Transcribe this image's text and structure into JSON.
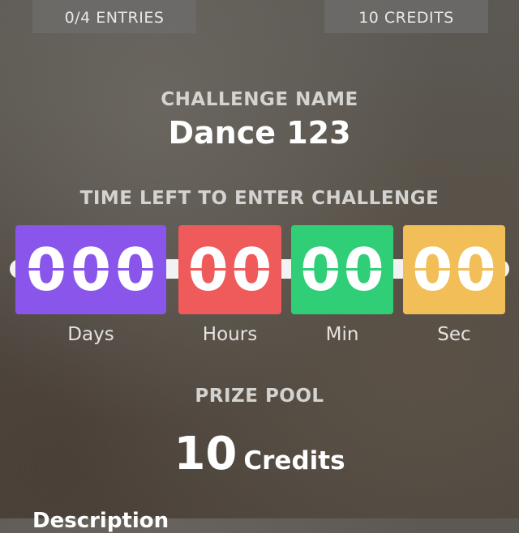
{
  "header": {
    "entries_label": "0/4 ENTRIES",
    "credits_label": "10 CREDITS"
  },
  "challenge": {
    "name_label": "CHALLENGE NAME",
    "name": "Dance 123"
  },
  "timer": {
    "label": "TIME LEFT TO ENTER CHALLENGE",
    "days": {
      "digits": [
        "0",
        "0",
        "0"
      ],
      "unit": "Days",
      "color": "#8a55ea"
    },
    "hours": {
      "digits": [
        "0",
        "0"
      ],
      "unit": "Hours",
      "color": "#ef5a5a"
    },
    "min": {
      "digits": [
        "0",
        "0"
      ],
      "unit": "Min",
      "color": "#2fce77"
    },
    "sec": {
      "digits": [
        "0",
        "0"
      ],
      "unit": "Sec",
      "color": "#f2be57"
    }
  },
  "prize": {
    "label": "PRIZE POOL",
    "amount": "10",
    "unit": "Credits"
  },
  "description": {
    "label": "Description"
  }
}
